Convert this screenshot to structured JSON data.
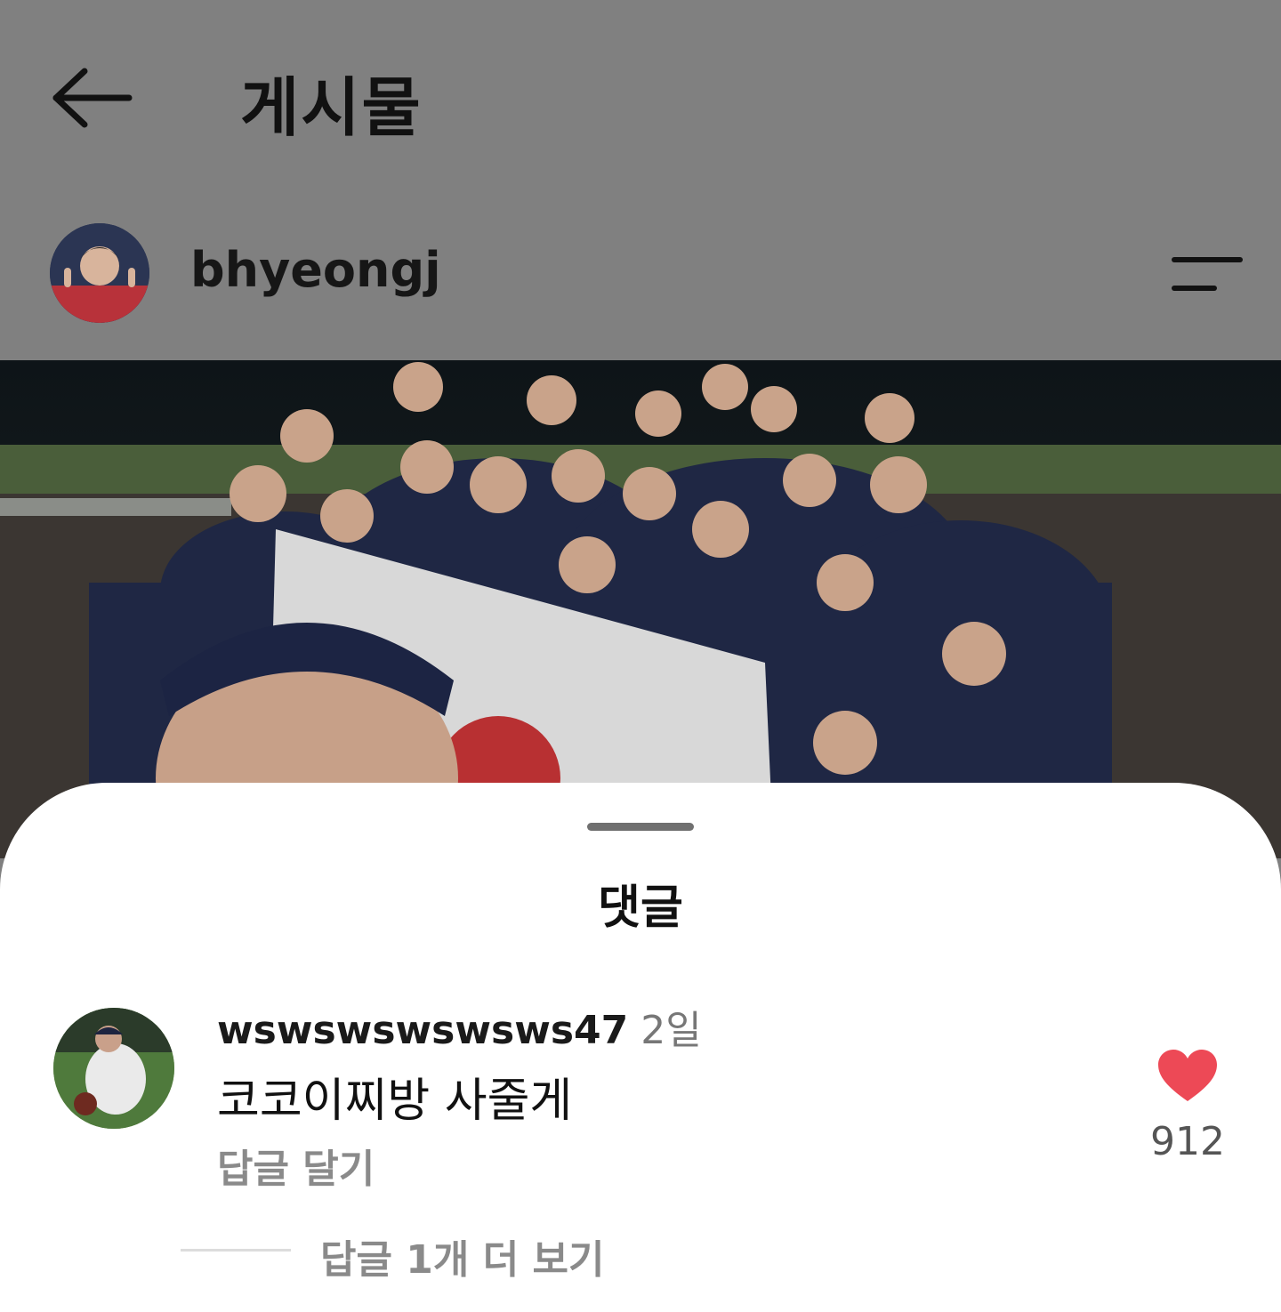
{
  "header": {
    "title": "게시물",
    "back_icon": "arrow-left-icon"
  },
  "post": {
    "author": "bhyeongj",
    "menu_icon": "menu-icon"
  },
  "comments_sheet": {
    "title": "댓글",
    "comments": [
      {
        "username": "wswswswswsws47",
        "time": "2일",
        "text": "코코이찌방 사줄게",
        "reply_label": "답글 달기",
        "likes": "912",
        "like_icon": "heart-icon",
        "like_color": "#ed4956",
        "more_replies_label": "답글 1개 더 보기"
      }
    ]
  }
}
